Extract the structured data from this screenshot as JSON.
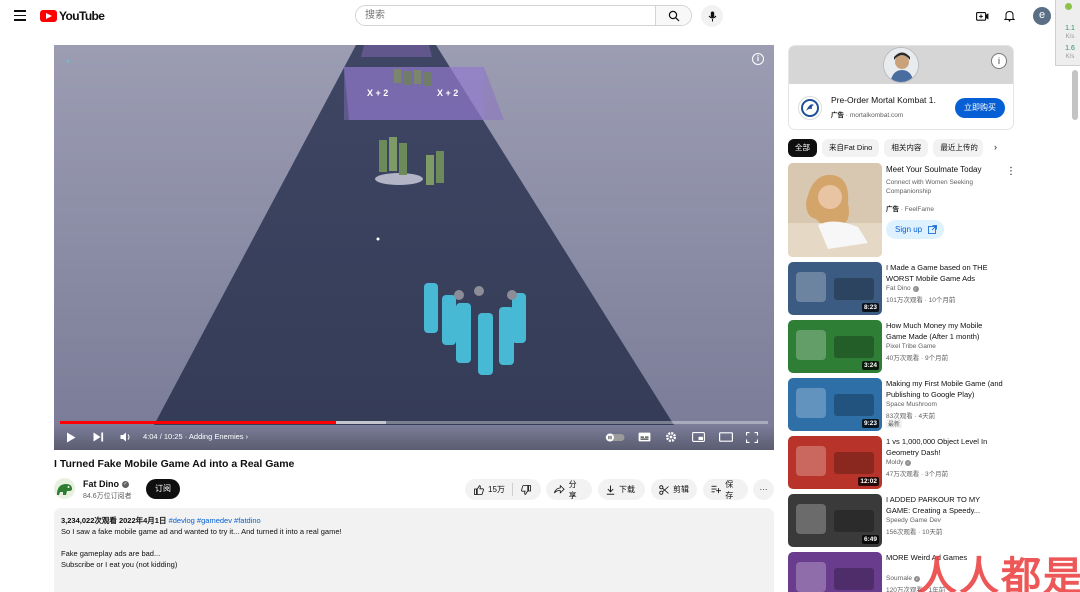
{
  "header": {
    "logo_text": "YouTube",
    "search_placeholder": "搜索"
  },
  "side_widget": {
    "up_value": "1.1",
    "up_unit": "K/s",
    "down_value": "1.6",
    "down_unit": "K/s"
  },
  "player": {
    "overlay_left": "X + 2",
    "overlay_right": "X + 2",
    "current_time": "4:04",
    "duration": "10:25",
    "chapter": "Adding Enemies",
    "progress": 0.39,
    "buffered": 0.46
  },
  "video": {
    "title": "I Turned Fake Mobile Game Ad into a Real Game",
    "channel_name": "Fat Dino",
    "subscribers": "84.6万位订阅者",
    "subscribe_label": "订阅",
    "likes": "15万",
    "share_label": "分享",
    "download_label": "下载",
    "clip_label": "剪辑",
    "save_label": "保存",
    "more_label": "···"
  },
  "description": {
    "views_date": "3,234,022次观看  2022年4月1日",
    "tags": "#devlog #gamedev #fatdino",
    "line1": "So I saw a fake mobile game ad and wanted to try it... And turned it into a real game!",
    "line2": "Fake gameplay ads are bad...",
    "line3": "Subscribe or I eat you (not kidding)"
  },
  "ad": {
    "title": "Pre-Order Mortal Kombat 1.",
    "label": "广告",
    "domain": "mortalkombat.com",
    "cta": "立即购买"
  },
  "chips": [
    "全部",
    "来自Fat Dino",
    "相关内容",
    "最近上传的"
  ],
  "sidebar_ad": {
    "title": "Meet Your Soulmate Today",
    "description": "Connect with Women Seeking Companionship",
    "label": "广告",
    "advertiser": "FeelFame",
    "cta": "Sign up"
  },
  "recommendations": [
    {
      "title": "I Made a Game based on THE WORST Mobile Game Ads",
      "channel": "Fat Dino",
      "verified": true,
      "meta": "101万次观看 · 10个月前",
      "duration": "8:23",
      "thumb_color": "#3c5b82"
    },
    {
      "title": "How Much Money my Mobile Game Made (After 1 month)",
      "channel": "Pixel Tribe Game",
      "verified": false,
      "meta": "40万次观看 · 9个月前",
      "duration": "3:24",
      "thumb_color": "#2f7e36"
    },
    {
      "title": "Making my First Mobile Game (and Publishing to Google Play)",
      "channel": "Space Mushroom",
      "verified": false,
      "meta": "83次观看 · 4天前",
      "badge": "最新",
      "duration": "9:23",
      "thumb_color": "#2e6fa8"
    },
    {
      "title": "1 vs 1,000,000 Object Level In Geometry Dash!",
      "channel": "Moldy",
      "verified": true,
      "meta": "47万次观看 · 3个月前",
      "duration": "12:02",
      "thumb_color": "#b8342a"
    },
    {
      "title": "I ADDED PARKOUR TO MY GAME: Creating a Speedy...",
      "channel": "Speedy Game Dev",
      "verified": false,
      "meta": "156次观看 · 10天前",
      "duration": "6:49",
      "thumb_color": "#3a3a3a"
    },
    {
      "title": "MORE Weird Ad Games",
      "channel": "Sournale",
      "verified": true,
      "meta": "120万次观看 · 1年前",
      "duration": "",
      "thumb_color": "#6a3c8e"
    }
  ],
  "watermark": "人人都是产品经理"
}
